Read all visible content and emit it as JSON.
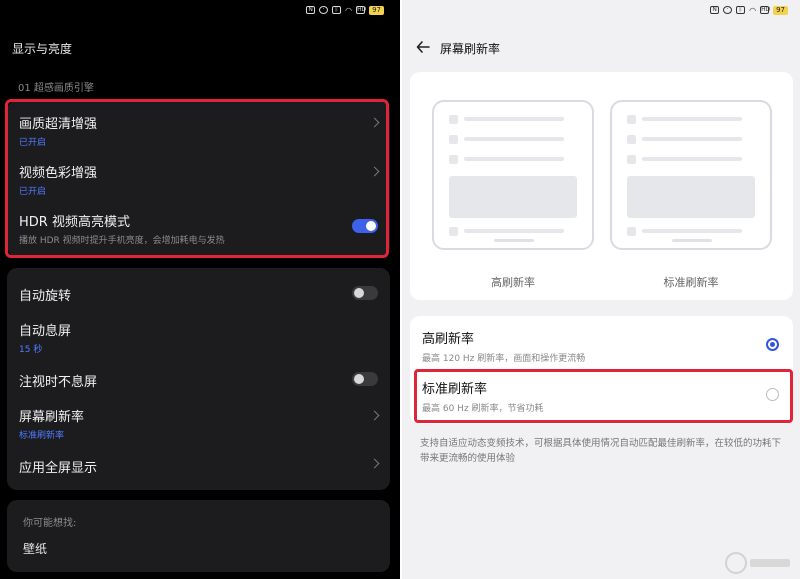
{
  "status_bar": {
    "battery": "97"
  },
  "left": {
    "title": "显示与亮度",
    "section_label": "01 超感画质引擎",
    "group1": [
      {
        "label": "画质超清增强",
        "sub": "已开启",
        "control": "chevron"
      },
      {
        "label": "视频色彩增强",
        "sub": "已开启",
        "control": "chevron"
      },
      {
        "label": "HDR 视频高亮模式",
        "sub": "播放 HDR 视频时提升手机亮度，会增加耗电与发热",
        "control": "toggle",
        "on": true
      }
    ],
    "group2": [
      {
        "label": "自动旋转",
        "control": "toggle",
        "on": false
      },
      {
        "label": "自动息屏",
        "sub": "15 秒"
      },
      {
        "label": "注视时不息屏",
        "control": "toggle",
        "on": false
      },
      {
        "label": "屏幕刷新率",
        "sub": "标准刷新率",
        "control": "chevron"
      },
      {
        "label": "应用全屏显示",
        "control": "chevron"
      }
    ],
    "suggestion": {
      "title": "你可能想找:",
      "item": "壁纸"
    }
  },
  "right": {
    "title": "屏幕刷新率",
    "preview": {
      "high_caption": "高刷新率",
      "standard_caption": "标准刷新率"
    },
    "options": [
      {
        "label": "高刷新率",
        "desc": "最高 120 Hz 刷新率，画面和操作更流畅",
        "selected": true
      },
      {
        "label": "标准刷新率",
        "desc": "最高 60 Hz 刷新率，节省功耗",
        "selected": false
      }
    ],
    "description": "支持自适应动态变频技术，可根据具体使用情况自动匹配最佳刷新率，在较低的功耗下带来更流畅的使用体验"
  },
  "colors": {
    "accent_blue": "#3b62e8",
    "highlight_red": "#e0243a",
    "dark_card": "#1c1c1e"
  }
}
